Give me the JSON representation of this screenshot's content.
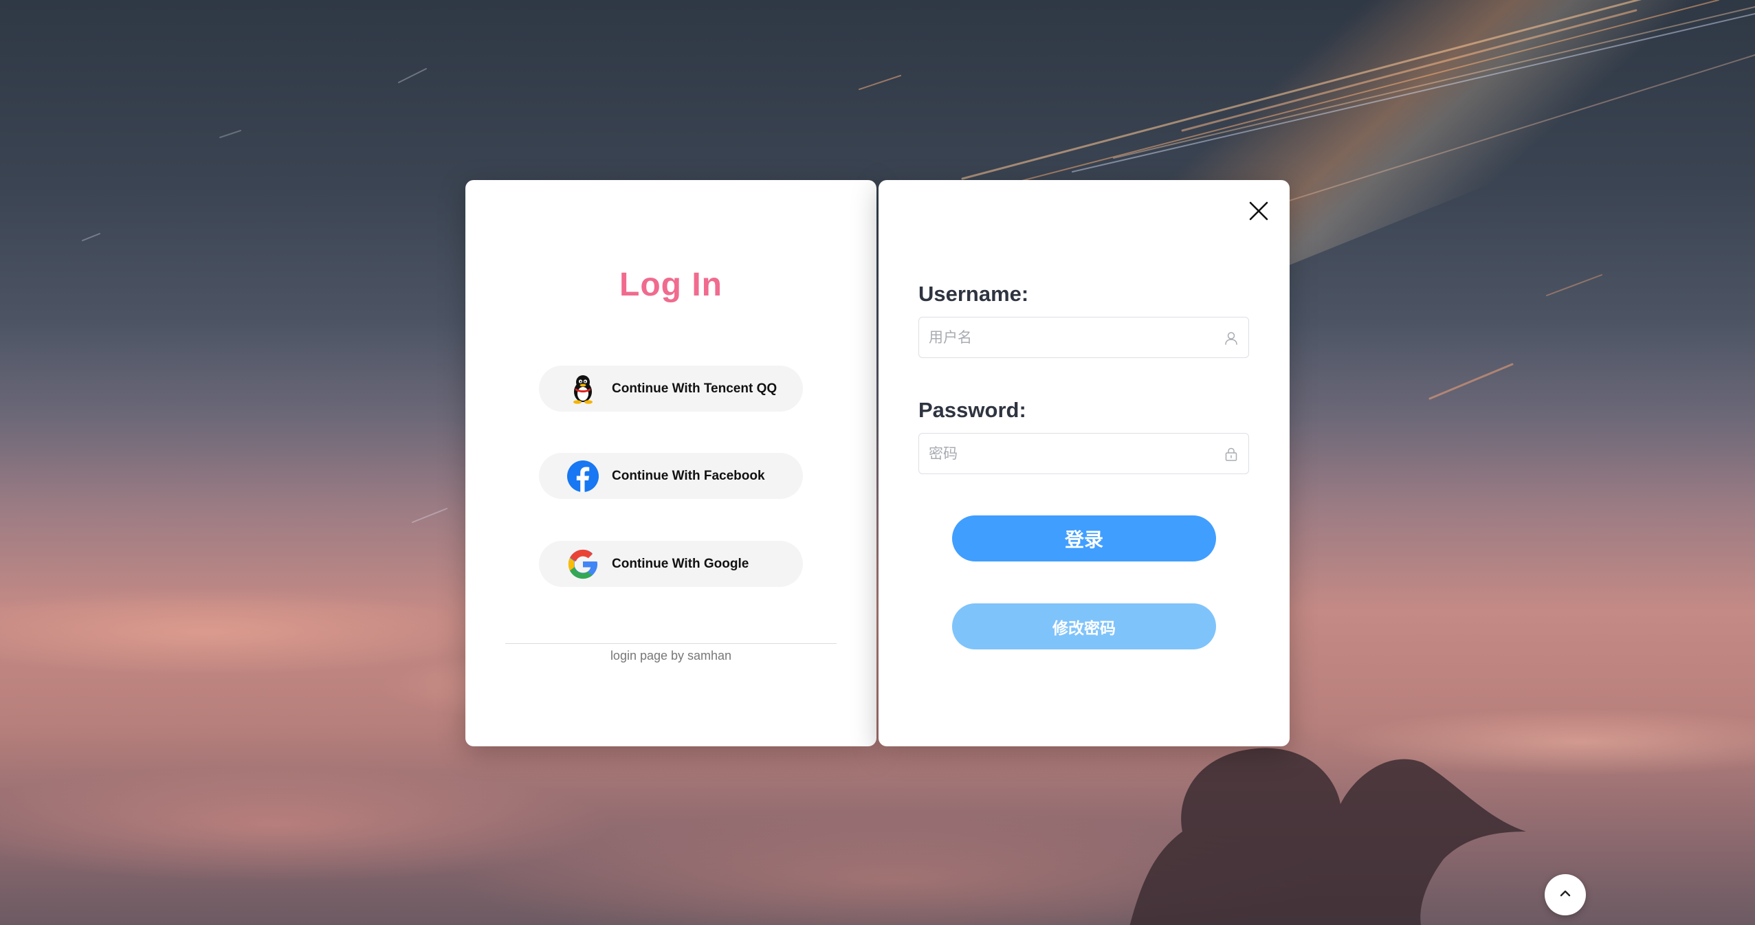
{
  "login_panel": {
    "title": "Log In",
    "social_buttons": [
      {
        "label": "Continue With Tencent QQ",
        "icon": "qq-penguin-icon"
      },
      {
        "label": "Continue With Facebook",
        "icon": "facebook-icon"
      },
      {
        "label": "Continue With Google",
        "icon": "google-icon"
      }
    ],
    "footer": "login page by samhan"
  },
  "form_panel": {
    "username_label": "Username:",
    "username_placeholder": "用户名",
    "username_value": "",
    "password_label": "Password:",
    "password_placeholder": "密码",
    "password_value": "",
    "login_button": "登录",
    "change_password_button": "修改密码"
  },
  "colors": {
    "title_pink": "#f06b8e",
    "primary_blue": "#409eff",
    "secondary_blue": "#7fc3fb",
    "facebook_blue": "#1877f2"
  },
  "icons": {
    "close": "close-icon",
    "user": "user-icon",
    "lock": "lock-icon",
    "scroll_top": "chevron-up-icon"
  }
}
